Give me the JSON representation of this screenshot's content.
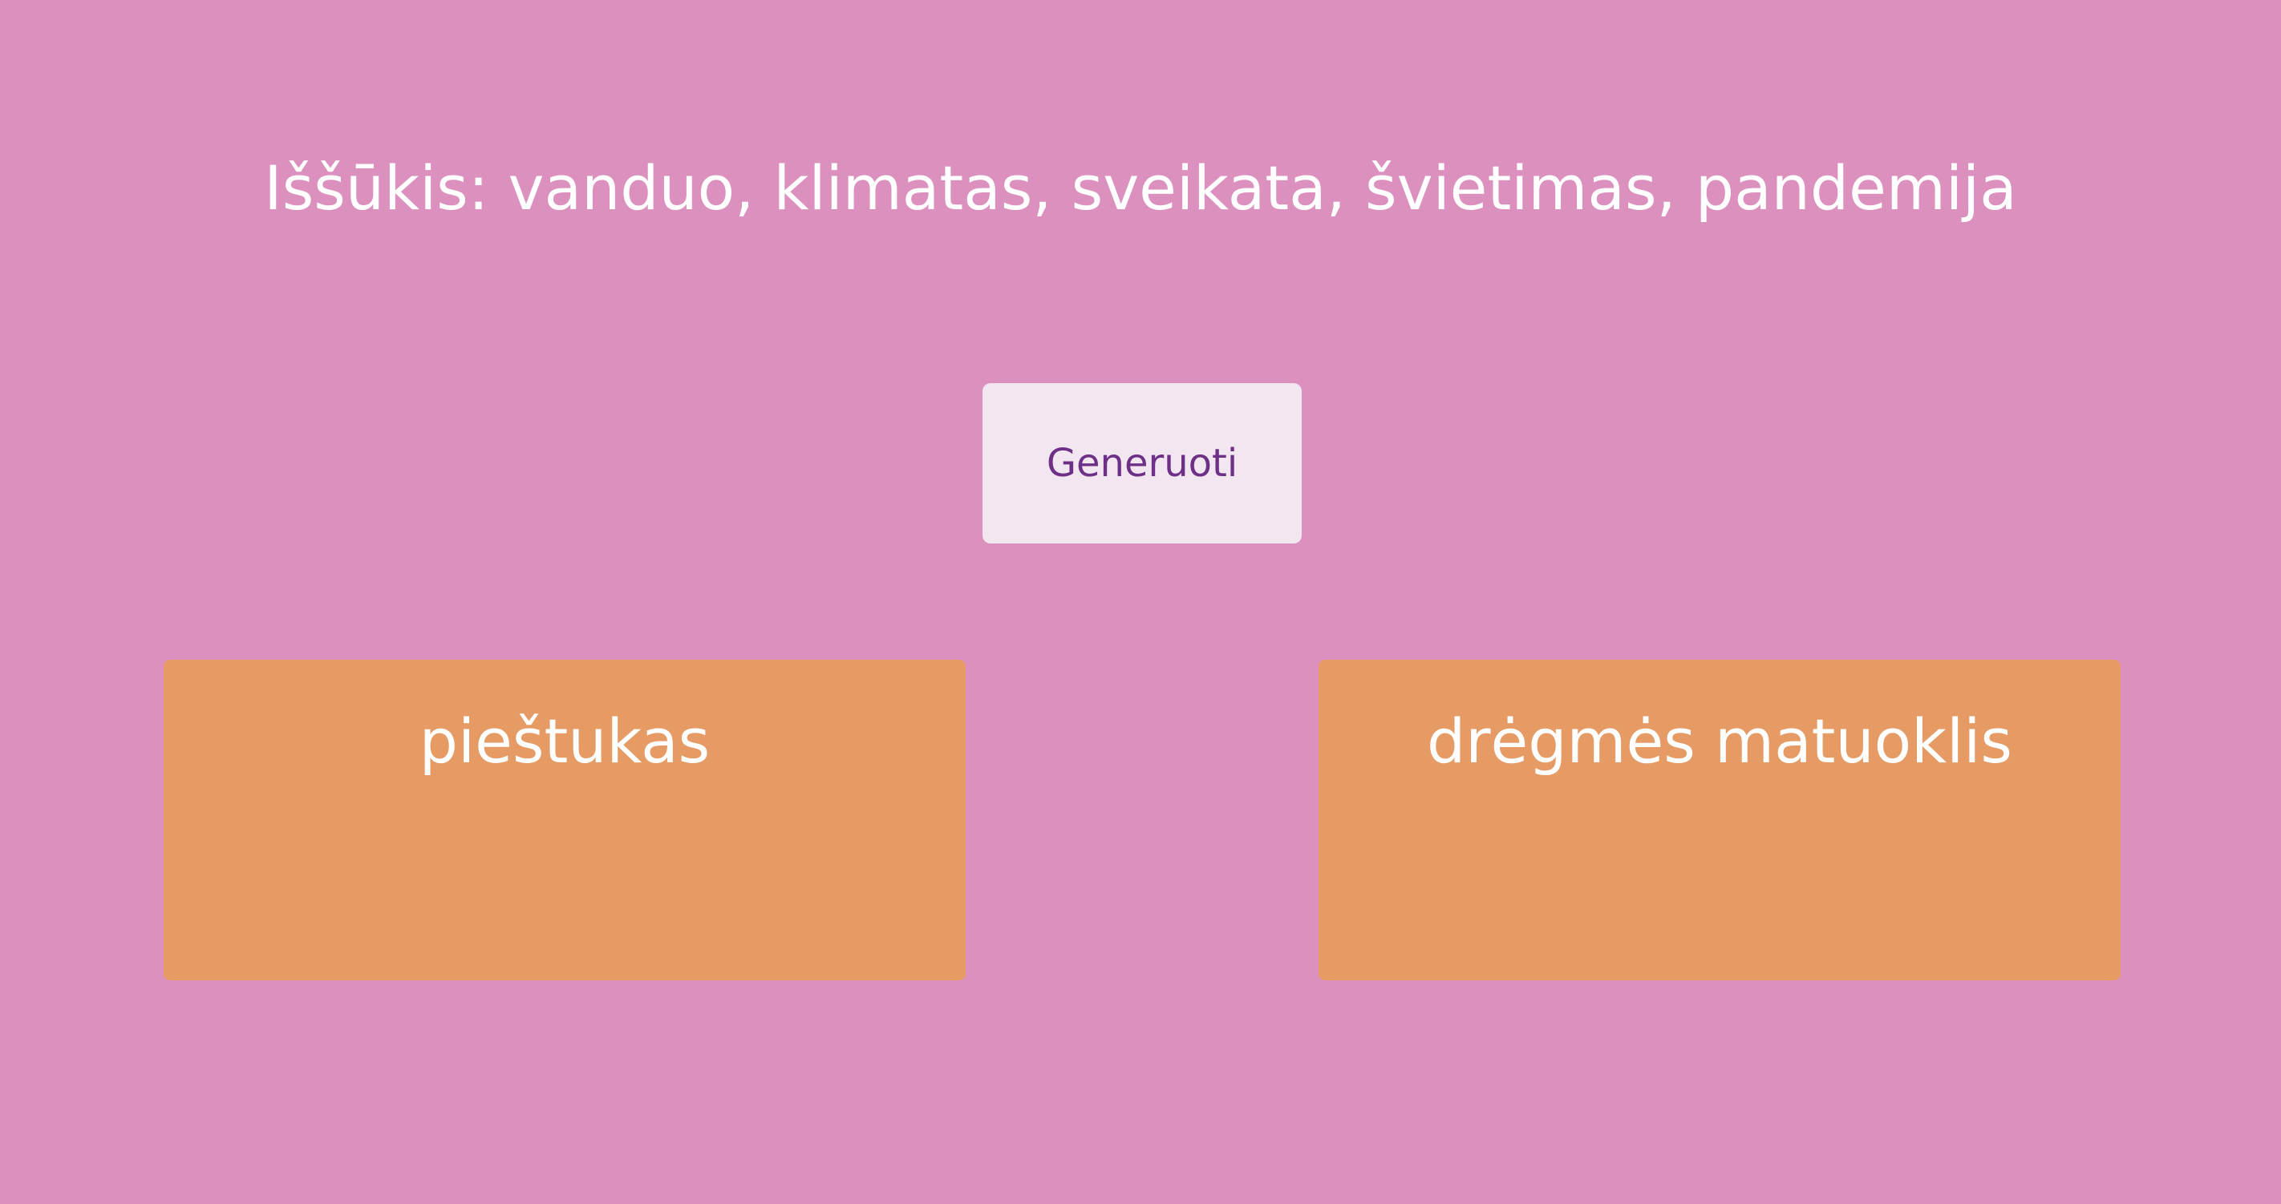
{
  "header": {
    "title": "Iššūkis: vanduo, klimatas, sveikata, švietimas, pandemija"
  },
  "actions": {
    "generate_label": "Generuoti"
  },
  "cards": [
    {
      "label": "pieštukas"
    },
    {
      "label": "drėgmės matuoklis"
    }
  ],
  "colors": {
    "background": "#dc90bd",
    "card": "#e69a64",
    "button_bg": "#f2e7f1",
    "button_text": "#6e2f86",
    "text": "#ffffff"
  }
}
